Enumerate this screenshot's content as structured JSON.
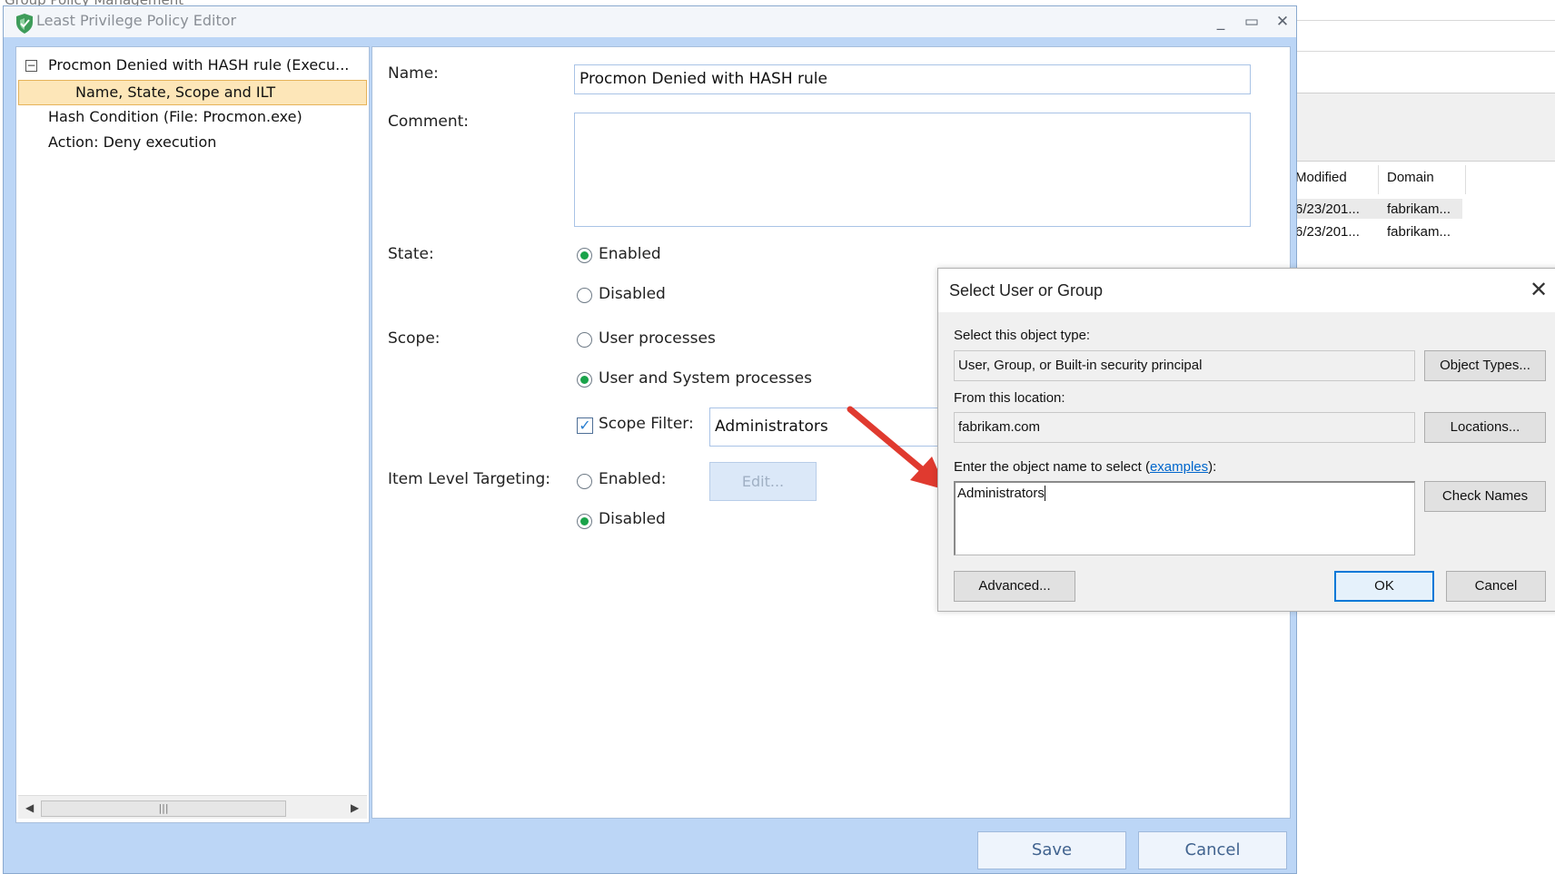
{
  "background_window": {
    "title": "Group Policy Management",
    "columns": [
      "Modified",
      "Domain"
    ],
    "rows": [
      {
        "modified": "6/23/201...",
        "domain": "fabrikam..."
      },
      {
        "modified": "6/23/201...",
        "domain": "fabrikam..."
      }
    ]
  },
  "editor": {
    "title": "Least Privilege Policy Editor",
    "window_controls": {
      "minimize": "_",
      "maximize": "▭",
      "close": "✕"
    },
    "tree": {
      "root": "Procmon Denied with HASH rule (Execu...",
      "expander": "−",
      "items": [
        "Name, State, Scope and ILT",
        "Hash Condition (File: Procmon.exe)",
        "Action: Deny execution"
      ],
      "selected_index": 0
    },
    "form": {
      "name_label": "Name:",
      "name_value": "Procmon Denied with HASH rule",
      "comment_label": "Comment:",
      "comment_value": "",
      "state_label": "State:",
      "state_options": [
        "Enabled",
        "Disabled"
      ],
      "state_selected": "Enabled",
      "scope_label": "Scope:",
      "scope_options": [
        "User processes",
        "User and System processes"
      ],
      "scope_selected": "User and System processes",
      "scope_filter_label": "Scope Filter:",
      "scope_filter_checked": true,
      "scope_filter_value": "Administrators",
      "ilt_label": "Item Level Targeting:",
      "ilt_options": [
        "Enabled:",
        "Disabled"
      ],
      "ilt_selected": "Disabled",
      "edit_button": "Edit..."
    },
    "footer": {
      "save": "Save",
      "cancel": "Cancel"
    }
  },
  "dialog": {
    "title": "Select User or Group",
    "close": "✕",
    "object_type_label": "Select this object type:",
    "object_type_value": "User, Group, or Built-in security principal",
    "object_types_button": "Object Types...",
    "location_label": "From this location:",
    "location_value": "fabrikam.com",
    "locations_button": "Locations...",
    "enter_label_prefix": "Enter the object name to select (",
    "enter_label_link": "examples",
    "enter_label_suffix": "):",
    "object_name_value": "Administrators",
    "check_names_button": "Check Names",
    "advanced_button": "Advanced...",
    "ok_button": "OK",
    "cancel_button": "Cancel"
  },
  "colors": {
    "editor_frame": "#bcd6f6",
    "tree_selection": "#fde6b8",
    "radio_selected": "#1aa34a",
    "annotation_arrow": "#e03a2f",
    "link": "#0066cc"
  }
}
